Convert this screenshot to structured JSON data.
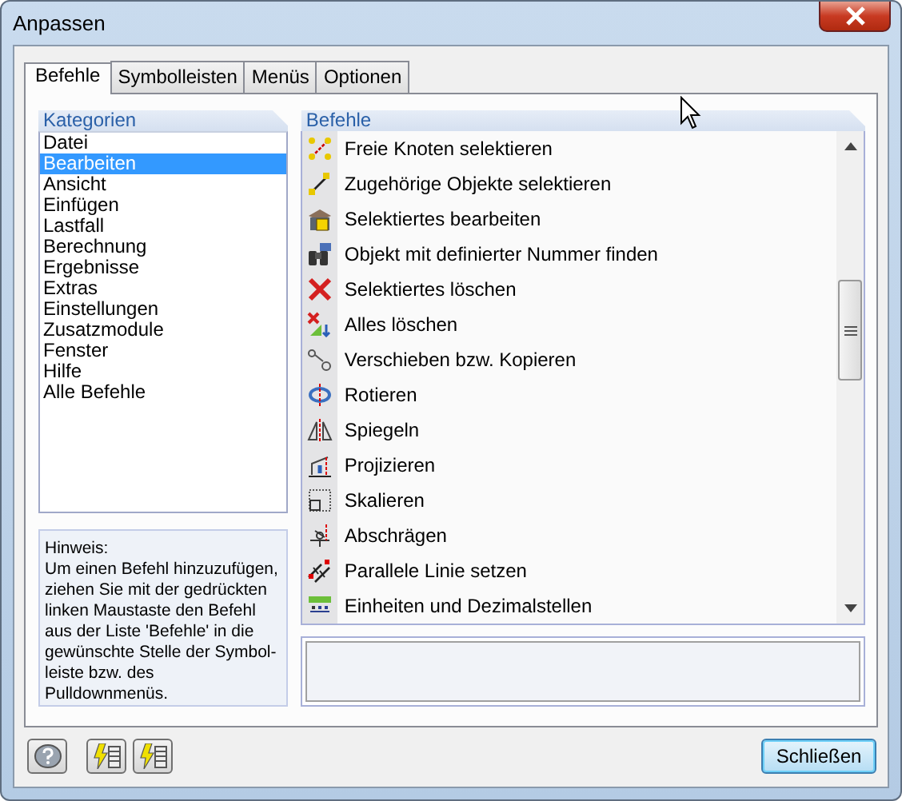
{
  "window": {
    "title": "Anpassen"
  },
  "tabs": [
    {
      "label": "Befehle",
      "selected": true
    },
    {
      "label": "Symbolleisten",
      "selected": false
    },
    {
      "label": "Menüs",
      "selected": false
    },
    {
      "label": "Optionen",
      "selected": false
    }
  ],
  "categories": {
    "heading": "Kategorien",
    "items": [
      {
        "label": "Datei",
        "selected": false
      },
      {
        "label": "Bearbeiten",
        "selected": true
      },
      {
        "label": "Ansicht",
        "selected": false
      },
      {
        "label": "Einfügen",
        "selected": false
      },
      {
        "label": "Lastfall",
        "selected": false
      },
      {
        "label": "Berechnung",
        "selected": false
      },
      {
        "label": "Ergebnisse",
        "selected": false
      },
      {
        "label": "Extras",
        "selected": false
      },
      {
        "label": "Einstellungen",
        "selected": false
      },
      {
        "label": "Zusatzmodule",
        "selected": false
      },
      {
        "label": "Fenster",
        "selected": false
      },
      {
        "label": "Hilfe",
        "selected": false
      },
      {
        "label": "Alle Befehle",
        "selected": false
      }
    ]
  },
  "hint": {
    "title": "Hinweis:",
    "lines": [
      "Um einen Befehl hinzuzufügen,",
      "ziehen Sie mit der gedrückten",
      "linken Maustaste den Befehl",
      "aus der Liste 'Befehle' in die",
      "gewünschte Stelle der Symbol-",
      "leiste bzw. des",
      "Pulldownmenüs."
    ]
  },
  "commands": {
    "heading": "Befehle",
    "items": [
      "Freie Knoten selektieren",
      "Zugehörige Objekte selektieren",
      "Selektiertes bearbeiten",
      "Objekt mit definierter Nummer finden",
      "Selektiertes löschen",
      "Alles löschen",
      "Verschieben bzw. Kopieren",
      "Rotieren",
      "Spiegeln",
      "Projizieren",
      "Skalieren",
      "Abschrägen",
      "Parallele Linie setzen",
      "Einheiten und Dezimalstellen"
    ]
  },
  "buttons": {
    "close": "Schließen"
  }
}
